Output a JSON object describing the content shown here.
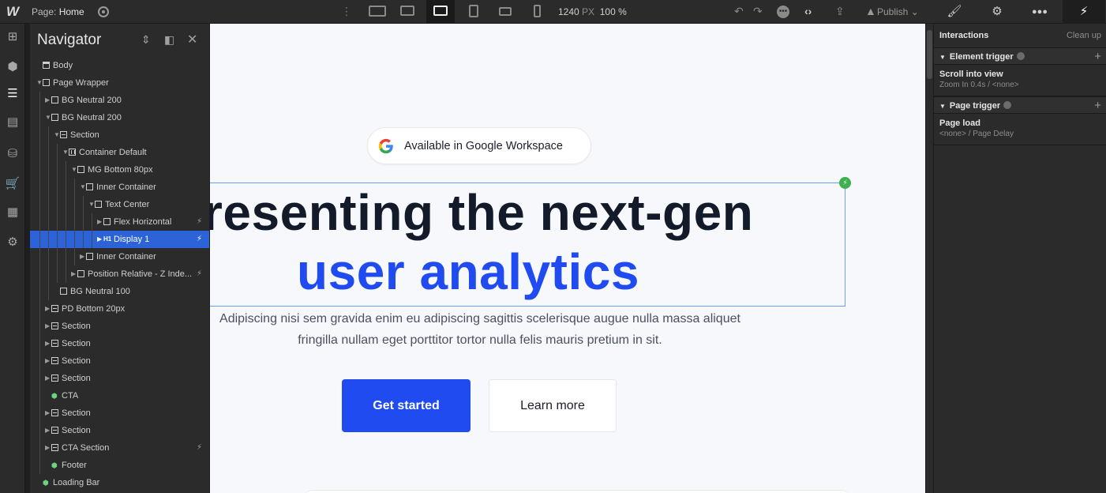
{
  "topbar": {
    "logo": "W",
    "page_prefix": "Page:",
    "page_name": "Home",
    "size_px": "1240",
    "size_unit": "PX",
    "zoom": "100 %",
    "publish_label": "Publish"
  },
  "navigator": {
    "title": "Navigator",
    "items": [
      {
        "label": "Body",
        "depth": 0,
        "type": "body",
        "caret": "none",
        "bolt": false,
        "selected": false
      },
      {
        "label": "Page Wrapper",
        "depth": 0,
        "type": "div",
        "caret": "open",
        "bolt": false,
        "selected": false
      },
      {
        "label": "BG Neutral 200",
        "depth": 1,
        "type": "div",
        "caret": "closed",
        "bolt": false,
        "selected": false
      },
      {
        "label": "BG Neutral 200",
        "depth": 1,
        "type": "div",
        "caret": "open",
        "bolt": false,
        "selected": false
      },
      {
        "label": "Section",
        "depth": 2,
        "type": "section",
        "caret": "open",
        "bolt": false,
        "selected": false
      },
      {
        "label": "Container Default",
        "depth": 3,
        "type": "container",
        "caret": "open",
        "bolt": false,
        "selected": false
      },
      {
        "label": "MG Bottom 80px",
        "depth": 4,
        "type": "div",
        "caret": "open",
        "bolt": false,
        "selected": false
      },
      {
        "label": "Inner Container",
        "depth": 5,
        "type": "div",
        "caret": "open",
        "bolt": false,
        "selected": false
      },
      {
        "label": "Text Center",
        "depth": 6,
        "type": "div",
        "caret": "open",
        "bolt": false,
        "selected": false
      },
      {
        "label": "Flex Horizontal",
        "depth": 7,
        "type": "div",
        "caret": "closed",
        "bolt": true,
        "selected": false
      },
      {
        "label": "Display 1",
        "depth": 7,
        "type": "heading",
        "caret": "closed",
        "bolt": true,
        "selected": true
      },
      {
        "label": "Inner Container",
        "depth": 5,
        "type": "div",
        "caret": "closed",
        "bolt": false,
        "selected": false
      },
      {
        "label": "Position Relative - Z Inde...",
        "depth": 4,
        "type": "div",
        "caret": "closed",
        "bolt": true,
        "selected": false
      },
      {
        "label": "BG Neutral 100",
        "depth": 2,
        "type": "div",
        "caret": "none",
        "bolt": false,
        "selected": false
      },
      {
        "label": "PD Bottom 20px",
        "depth": 1,
        "type": "section",
        "caret": "closed",
        "bolt": false,
        "selected": false
      },
      {
        "label": "Section",
        "depth": 1,
        "type": "section",
        "caret": "closed",
        "bolt": false,
        "selected": false
      },
      {
        "label": "Section",
        "depth": 1,
        "type": "section",
        "caret": "closed",
        "bolt": false,
        "selected": false
      },
      {
        "label": "Section",
        "depth": 1,
        "type": "section",
        "caret": "closed",
        "bolt": false,
        "selected": false
      },
      {
        "label": "Section",
        "depth": 1,
        "type": "section",
        "caret": "closed",
        "bolt": false,
        "selected": false
      },
      {
        "label": "CTA",
        "depth": 1,
        "type": "symbol",
        "caret": "none",
        "bolt": false,
        "selected": false
      },
      {
        "label": "Section",
        "depth": 1,
        "type": "section",
        "caret": "closed",
        "bolt": false,
        "selected": false
      },
      {
        "label": "Section",
        "depth": 1,
        "type": "section",
        "caret": "closed",
        "bolt": false,
        "selected": false
      },
      {
        "label": "CTA Section",
        "depth": 1,
        "type": "section",
        "caret": "closed",
        "bolt": true,
        "selected": false
      },
      {
        "label": "Footer",
        "depth": 1,
        "type": "symbol",
        "caret": "none",
        "bolt": false,
        "selected": false
      },
      {
        "label": "Loading Bar",
        "depth": 0,
        "type": "symbol",
        "caret": "none",
        "bolt": false,
        "selected": false
      }
    ]
  },
  "canvas": {
    "pill_text": "Available in Google Workspace",
    "heading_line1": "resenting the next-gen",
    "heading_line2": "user analytics",
    "paragraph": "Adipiscing nisi sem gravida enim eu adipiscing sagittis scelerisque augue nulla massa aliquet fringilla nullam eget porttitor tortor nulla felis mauris pretium in sit.",
    "primary_button": "Get started",
    "secondary_button": "Learn more",
    "accent_color": "#1f4bf0",
    "heading_color": "#131a29"
  },
  "interactions": {
    "title": "Interactions",
    "clean_up": "Clean up",
    "element_trigger_label": "Element trigger",
    "element_trigger_item_title": "Scroll into view",
    "element_trigger_item_sub": "Zoom In 0.4s / <none>",
    "page_trigger_label": "Page trigger",
    "page_trigger_item_title": "Page load",
    "page_trigger_item_sub": "<none> / Page Delay"
  },
  "colors": {
    "selection": "#2d63d8",
    "panel_bg": "#2b2b2b",
    "symbol_green": "#6bd27d"
  }
}
